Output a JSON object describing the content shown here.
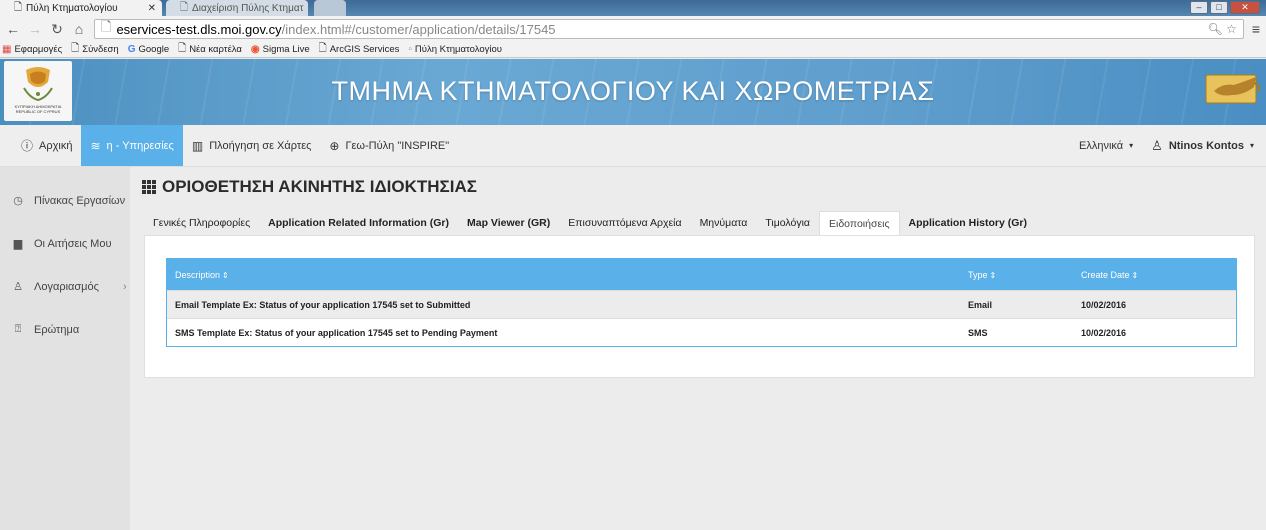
{
  "browser": {
    "tabs": [
      {
        "title": "Πύλη Κτηματολογίου",
        "active": true
      },
      {
        "title": "Διαχείριση Πύλης Κτηματ",
        "active": false
      }
    ],
    "url_host": "eservices-test.dls.moi.gov.cy",
    "url_path": "/index.html#/customer/application/details/17545",
    "bookmarks": [
      "Εφαρμογές",
      "Σύνδεση",
      "Google",
      "Νέα καρτέλα",
      "Sigma Live",
      "ArcGIS Services",
      "Πύλη Κτηματολογίου"
    ]
  },
  "banner": {
    "title": "ΤΜΗΜΑ ΚΤΗΜΑΤΟΛΟΓΙΟΥ ΚΑΙ ΧΩΡΟΜΕΤΡΙΑΣ",
    "logo_line1": "ΚΥΠΡΙΑΚΗ ΔΗΜΟΚΡΑΤΙΑ",
    "logo_line2": "REPUBLIC OF CYPRUS"
  },
  "topnav": {
    "home": "Αρχική",
    "eservices": "η - Υπηρεσίες",
    "maps": "Πλοήγηση σε Χάρτες",
    "geoportal": "Γεω-Πύλη \"INSPIRE\"",
    "language": "Ελληνικά",
    "user": "Ntinos Kontos"
  },
  "sidebar": {
    "items": [
      {
        "label": "Πίνακας Εργασίων",
        "icon": "clock-icon"
      },
      {
        "label": "Οι Αιτήσεις Μου",
        "icon": "briefcase-icon"
      },
      {
        "label": "Λογαριασμός",
        "icon": "user-icon"
      },
      {
        "label": "Ερώτημα",
        "icon": "question-icon"
      }
    ]
  },
  "page": {
    "title": "ΟΡΙΟΘΕΤΗΣΗ ΑΚΙΝΗΤΗΣ ΙΔΙΟΚΤΗΣΙΑΣ",
    "tabs": [
      "Γενικές Πληροφορίες",
      "Application Related Information (Gr)",
      "Map Viewer (GR)",
      "Επισυναπτόμενα Αρχεία",
      "Μηνύματα",
      "Τιμολόγια",
      "Ειδοποιήσεις",
      "Application History (Gr)"
    ],
    "active_tab": "Ειδοποιήσεις"
  },
  "notifications": {
    "columns": [
      "Description",
      "Type",
      "Create Date"
    ],
    "rows": [
      {
        "description": "Email Template Ex: Status of your application 17545 set to Submitted",
        "type": "Email",
        "date": "10/02/2016"
      },
      {
        "description": "SMS Template Ex: Status of your application 17545 set to Pending Payment",
        "type": "SMS",
        "date": "10/02/2016"
      }
    ]
  },
  "colors": {
    "accent": "#5ab0e8",
    "banner": "#5f9ecd"
  }
}
